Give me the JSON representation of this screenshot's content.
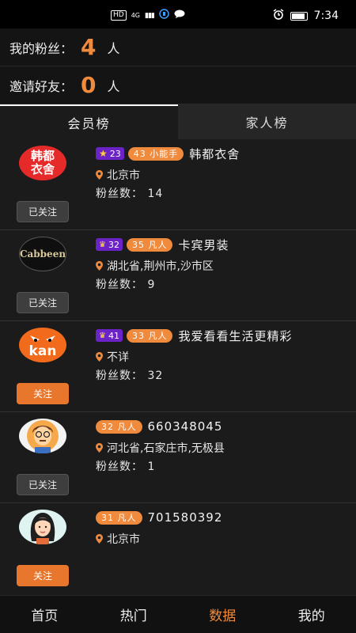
{
  "status_bar": {
    "hd": "HD",
    "net": "4G",
    "signal": "▮▮▮",
    "time": "7:34"
  },
  "stats": {
    "fans_label": "我的粉丝：",
    "fans_value": "4",
    "fans_unit": "人",
    "invite_label": "邀请好友：",
    "invite_value": "0",
    "invite_unit": "人"
  },
  "tabs": [
    {
      "label": "会员榜"
    },
    {
      "label": "家人榜"
    }
  ],
  "members": [
    {
      "name": "韩都衣舍",
      "level": "23",
      "level_icon": "star-icon",
      "rank": "43 小能手",
      "location": "北京市",
      "fans": "粉丝数：  14",
      "button": "已关注",
      "followed": true,
      "avatar": "handu-logo"
    },
    {
      "name": "卡宾男装",
      "level": "32",
      "level_icon": "crown-icon",
      "rank": "35 凡人",
      "location": "湖北省,荆州市,沙市区",
      "fans": "粉丝数：  9",
      "button": "已关注",
      "followed": true,
      "avatar": "cabbeen-logo"
    },
    {
      "name": "我爱看看生活更精彩",
      "level": "41",
      "level_icon": "crown-icon",
      "rank": "33 凡人",
      "location": "不详",
      "fans": "粉丝数：  32",
      "button": "关注",
      "followed": false,
      "avatar": "kan-logo"
    },
    {
      "name": "660348045",
      "level": "",
      "rank": "32 凡人",
      "location": "河北省,石家庄市,无极县",
      "fans": "粉丝数：  1",
      "button": "已关注",
      "followed": true,
      "avatar": "man-avatar"
    },
    {
      "name": "701580392",
      "level": "",
      "rank": "31 凡人",
      "location": "北京市",
      "fans": "",
      "button": "关注",
      "followed": false,
      "avatar": "woman-avatar"
    }
  ],
  "nav": [
    {
      "label": "首页"
    },
    {
      "label": "热门"
    },
    {
      "label": "数据"
    },
    {
      "label": "我的"
    }
  ],
  "colors": {
    "accent": "#f08a3c",
    "level_purple": "#6b22c7",
    "background": "#1b1b1b"
  },
  "logos": {
    "handu_line1": "韩都",
    "handu_line2": "衣舍",
    "cabbeen": "Cabbeen",
    "kan": "kan"
  }
}
